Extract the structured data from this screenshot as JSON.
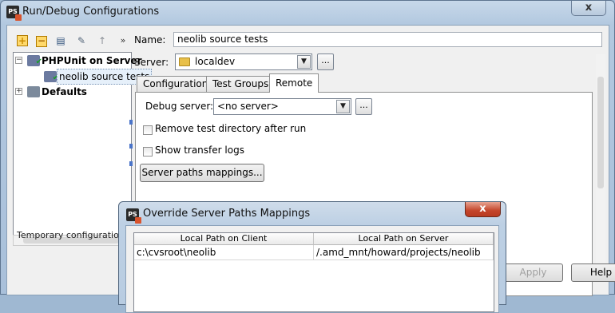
{
  "window": {
    "title": "Run/Debug Configurations",
    "app_icon": "PS",
    "close_symbol": "x"
  },
  "toolbar": {
    "add_symbol": "+",
    "remove_symbol": "−",
    "copy_symbol": "▤",
    "edit_symbol": "✎",
    "up_symbol": "↑",
    "more_symbol": "»"
  },
  "tree": {
    "items": [
      {
        "label": "PHPUnit on Server",
        "expander": "−",
        "icon": "phpunit-icon"
      },
      {
        "label": "neolib source tests",
        "icon": "phpunit-config-icon"
      },
      {
        "label": "Defaults",
        "expander": "+",
        "icon": "defaults-icon"
      }
    ]
  },
  "temp_config_text": "Temporary configurations li",
  "name": {
    "label": "Name:",
    "value": "neolib source tests"
  },
  "server": {
    "label": "Server:",
    "value": "localdev",
    "ellipsis": "..."
  },
  "tabs": [
    {
      "label": "Configuration"
    },
    {
      "label": "Test Groups"
    },
    {
      "label": "Remote",
      "active": true
    }
  ],
  "remote": {
    "debug_server_label": "Debug server:",
    "debug_server_value": "<no server>",
    "debug_server_ellipsis": "...",
    "remove_dir_label": "Remove test directory after run",
    "show_logs_label": "Show transfer logs",
    "paths_button": "Server paths mappings..."
  },
  "bottom_buttons": {
    "apply": "Apply",
    "help": "Help"
  },
  "popup": {
    "title": "Override Server Paths Mappings",
    "app_icon": "PS",
    "close_symbol": "x",
    "columns": [
      "Local Path on Client",
      "Local Path on Server"
    ],
    "rows": [
      {
        "client": "c:\\cvsroot\\neolib",
        "server": "/.amd_mnt/howard/projects/neolib"
      }
    ]
  },
  "colors": {
    "title_bar": "#b2c8df",
    "popup_close": "#c4452a",
    "accent": "#4a74c9"
  }
}
